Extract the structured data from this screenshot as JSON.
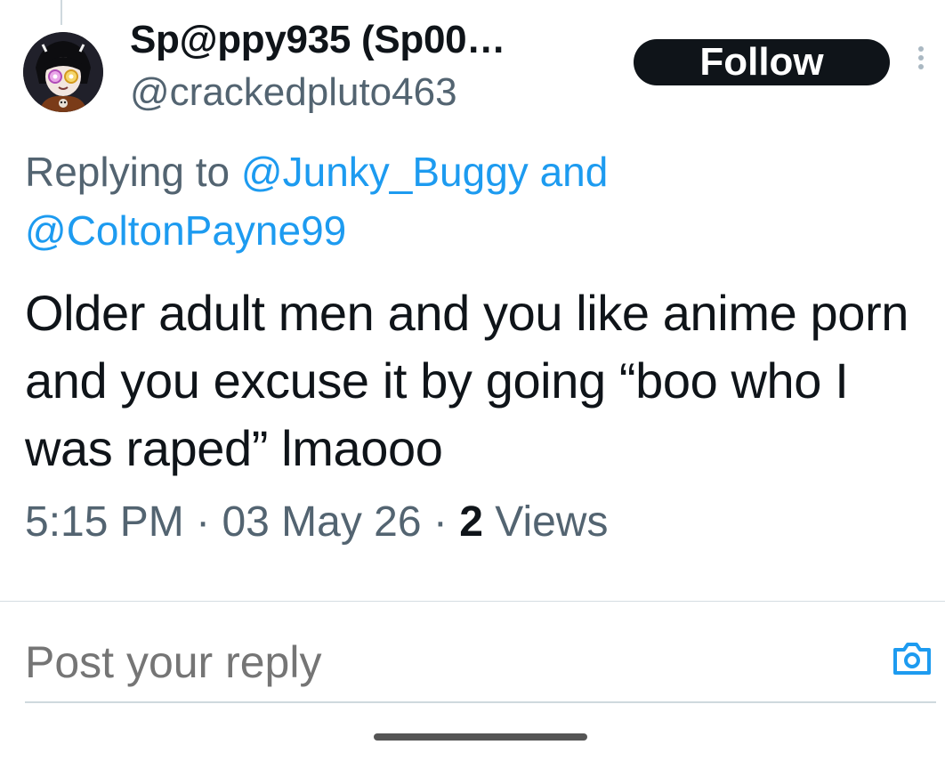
{
  "author": {
    "display_name": "Sp@ppy935 (Sp00…",
    "handle": "@crackedpluto463",
    "avatar_icon": "anime-avatar"
  },
  "actions": {
    "follow_label": "Follow",
    "more_icon": "more-vertical-icon"
  },
  "reply_context": {
    "prefix": "Replying to",
    "mention_1": "@Junky_Buggy",
    "connector": "and",
    "mention_2": "@ColtonPayne99"
  },
  "tweet": {
    "text": "Older adult men and you like anime porn and you excuse it by going “boo who I was raped” lmaooo",
    "time": "5:15 PM",
    "separator": "·",
    "date": "03 May 26",
    "views_count": "2",
    "views_label": "Views"
  },
  "reply_box": {
    "placeholder": "Post your reply",
    "camera_icon": "camera-icon"
  },
  "colors": {
    "accent": "#1d9bf0",
    "text": "#0f1419",
    "secondary": "#536471"
  }
}
